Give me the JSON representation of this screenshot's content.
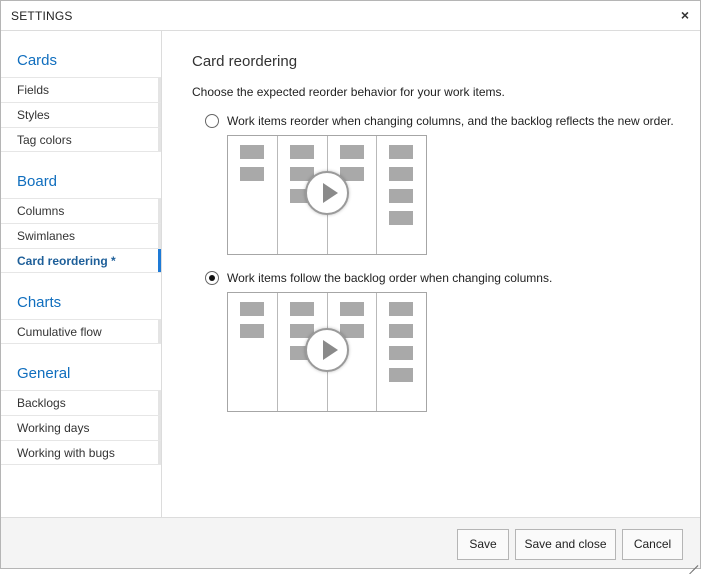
{
  "dialog": {
    "title": "SETTINGS",
    "close_glyph": "×"
  },
  "sidebar": {
    "groups": [
      {
        "title": "Cards",
        "items": [
          {
            "label": "Fields"
          },
          {
            "label": "Styles"
          },
          {
            "label": "Tag colors"
          }
        ]
      },
      {
        "title": "Board",
        "items": [
          {
            "label": "Columns"
          },
          {
            "label": "Swimlanes"
          },
          {
            "label": "Card reordering *",
            "selected": true
          }
        ]
      },
      {
        "title": "Charts",
        "items": [
          {
            "label": "Cumulative flow"
          }
        ]
      },
      {
        "title": "General",
        "items": [
          {
            "label": "Backlogs"
          },
          {
            "label": "Working days"
          },
          {
            "label": "Working with bugs"
          }
        ]
      }
    ]
  },
  "content": {
    "heading": "Card reordering",
    "description": "Choose the expected reorder behavior for your work items.",
    "options": [
      {
        "label": "Work items reorder when changing columns, and the backlog reflects the new order.",
        "checked": false,
        "preview_icon": "play-icon"
      },
      {
        "label": "Work items follow the backlog order when changing columns.",
        "checked": true,
        "preview_icon": "play-icon"
      }
    ]
  },
  "footer": {
    "save_label": "Save",
    "save_close_label": "Save and close",
    "cancel_label": "Cancel"
  },
  "colors": {
    "accent": "#106ebe",
    "selected_item": "#1e5f99",
    "selected_bar": "#1e7ad6",
    "card_gray": "#a9a9a9"
  }
}
